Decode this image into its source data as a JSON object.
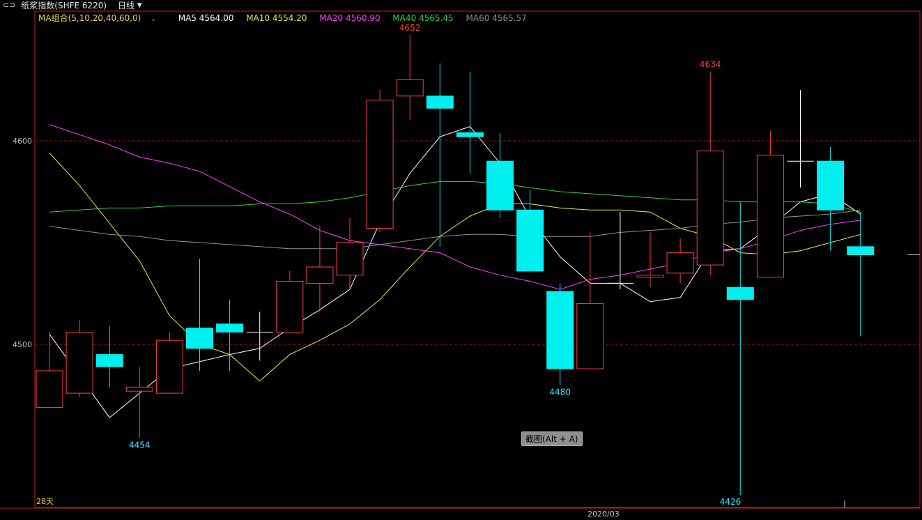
{
  "header": {
    "title_icon": "link-icon",
    "title": "纸浆指数(SHFE 6220)",
    "period": "日线",
    "period_dropdown_icon": "chevron-down-icon"
  },
  "ma_legend": {
    "group_label": "MA组合(5,10,20,40,60,0)",
    "items": [
      {
        "label": "MA5 4564.00",
        "color": "#ffffff"
      },
      {
        "label": "MA10 4554.20",
        "color": "#e8e84a"
      },
      {
        "label": "MA20 4560.90",
        "color": "#ff3cff"
      },
      {
        "label": "MA40 4565.45",
        "color": "#33d633"
      },
      {
        "label": "MA60 4565.57",
        "color": "#909090"
      }
    ]
  },
  "colors": {
    "up": "#ff4040",
    "down": "#00f0f0",
    "doji": "#ffffff",
    "grid": "#8a1a1a",
    "border": "#c81e1e",
    "axis_text": "#bfbfbf",
    "max_label": "#ff4040",
    "min_label": "#33e6ff"
  },
  "footer": {
    "days_label": "28天",
    "date_label": "2020/03",
    "screenshot_hint": "截图(Alt + A)"
  },
  "chart_data": {
    "type": "candlestick",
    "ylim": [
      4420,
      4672
    ],
    "yticks": [
      4500,
      4600
    ],
    "grid": "dashed horizontal at y ticks",
    "annotations": [
      {
        "text": "4652",
        "index": 12,
        "value": 4652,
        "kind": "high"
      },
      {
        "text": "4634",
        "index": 22,
        "value": 4634,
        "kind": "high"
      },
      {
        "text": "4480",
        "index": 17,
        "value": 4480,
        "kind": "low"
      },
      {
        "text": "4454",
        "index": 3,
        "value": 4454,
        "kind": "low"
      },
      {
        "text": "4426",
        "index": 23,
        "value": 4426,
        "kind": "low"
      }
    ],
    "candles": [
      {
        "o": 4469,
        "h": 4506,
        "l": 4469,
        "c": 4487
      },
      {
        "o": 4476,
        "h": 4512,
        "l": 4474,
        "c": 4506
      },
      {
        "o": 4495,
        "h": 4509,
        "l": 4479,
        "c": 4489
      },
      {
        "o": 4477,
        "h": 4489,
        "l": 4454,
        "c": 4479
      },
      {
        "o": 4476,
        "h": 4506,
        "l": 4476,
        "c": 4502
      },
      {
        "o": 4508,
        "h": 4542,
        "l": 4487,
        "c": 4498
      },
      {
        "o": 4510,
        "h": 4522,
        "l": 4487,
        "c": 4506
      },
      {
        "o": 4506,
        "h": 4516,
        "l": 4492,
        "c": 4506
      },
      {
        "o": 4506,
        "h": 4536,
        "l": 4506,
        "c": 4531
      },
      {
        "o": 4530,
        "h": 4558,
        "l": 4516,
        "c": 4538
      },
      {
        "o": 4534,
        "h": 4562,
        "l": 4527,
        "c": 4550
      },
      {
        "o": 4557,
        "h": 4625,
        "l": 4555,
        "c": 4620
      },
      {
        "o": 4622,
        "h": 4652,
        "l": 4610,
        "c": 4630
      },
      {
        "o": 4622,
        "h": 4638,
        "l": 4548,
        "c": 4616
      },
      {
        "o": 4604,
        "h": 4634,
        "l": 4584,
        "c": 4602
      },
      {
        "o": 4590,
        "h": 4604,
        "l": 4562,
        "c": 4566
      },
      {
        "o": 4566,
        "h": 4576,
        "l": 4547,
        "c": 4536
      },
      {
        "o": 4526,
        "h": 4530,
        "l": 4480,
        "c": 4488
      },
      {
        "o": 4488,
        "h": 4555,
        "l": 4488,
        "c": 4520
      },
      {
        "o": 4530,
        "h": 4565,
        "l": 4527,
        "c": 4530
      },
      {
        "o": 4533,
        "h": 4555,
        "l": 4528,
        "c": 4534
      },
      {
        "o": 4535,
        "h": 4552,
        "l": 4530,
        "c": 4545
      },
      {
        "o": 4539,
        "h": 4634,
        "l": 4534,
        "c": 4595
      },
      {
        "o": 4528,
        "h": 4570,
        "l": 4426,
        "c": 4522
      },
      {
        "o": 4533,
        "h": 4605,
        "l": 4533,
        "c": 4593
      },
      {
        "o": 4590,
        "h": 4625,
        "l": 4577,
        "c": 4590
      },
      {
        "o": 4590,
        "h": 4597,
        "l": 4546,
        "c": 4566
      },
      {
        "o": 4548,
        "h": 4565,
        "l": 4504,
        "c": 4544
      }
    ],
    "series": [
      {
        "name": "MA5",
        "color": "#ffffff",
        "values": [
          4505,
          null,
          4464,
          null,
          4488,
          null,
          4495,
          4498,
          4508,
          4517,
          4527,
          4560,
          4584,
          4602,
          4607,
          4589,
          4562,
          4543,
          4530,
          4530,
          4521,
          4523,
          4546,
          4547,
          4558,
          4570,
          4574,
          4564
        ]
      },
      {
        "name": "MA10",
        "color": "#e8e84a",
        "values": [
          4594,
          4578,
          null,
          4541,
          4514,
          4500,
          4495,
          4482,
          4495,
          4502,
          4510,
          4522,
          4538,
          4553,
          4563,
          4569,
          4569,
          4567,
          4566,
          4566,
          4565,
          4557,
          4553,
          4545,
          4544,
          4546,
          4550,
          4554
        ]
      },
      {
        "name": "MA20",
        "color": "#ff3cff",
        "values": [
          4608,
          4603,
          4598,
          4592,
          4589,
          4585,
          null,
          4570,
          4564,
          4556,
          4551,
          4549,
          4547,
          4545,
          4538,
          4534,
          4531,
          4527,
          4532,
          4534,
          4537,
          4540,
          4545,
          4547,
          4551,
          4556,
          4559,
          4561
        ]
      },
      {
        "name": "MA40",
        "color": "#33d633",
        "values": [
          4565,
          4566,
          4567,
          4567,
          4568,
          4568,
          4568,
          4569,
          4569,
          4570,
          4572,
          4575,
          4578,
          4580,
          4580,
          4579,
          4577,
          4575,
          4574,
          4573,
          4572,
          4571,
          4571,
          4570,
          4570,
          4570,
          4569,
          4565
        ]
      },
      {
        "name": "MA60",
        "color": "#909090",
        "values": [
          4558,
          4556,
          4554,
          4553,
          4551,
          4550,
          4549,
          4548,
          4547,
          4547,
          4547,
          4549,
          4551,
          4553,
          4554,
          4554,
          4553,
          4553,
          4553,
          4555,
          4556,
          4557,
          4559,
          4560,
          4562,
          4563,
          4564,
          4566
        ]
      }
    ]
  }
}
